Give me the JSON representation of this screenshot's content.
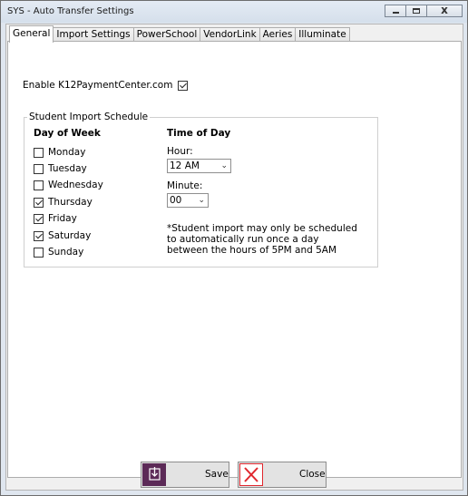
{
  "window": {
    "title": "SYS - Auto Transfer Settings",
    "close_glyph": "x"
  },
  "tabs": [
    {
      "label": "General",
      "active": true
    },
    {
      "label": "Import Settings",
      "active": false
    },
    {
      "label": "PowerSchool",
      "active": false
    },
    {
      "label": "VendorLink",
      "active": false
    },
    {
      "label": "Aeries",
      "active": false
    },
    {
      "label": "Illuminate",
      "active": false
    }
  ],
  "general": {
    "enable_label": "Enable K12PaymentCenter.com",
    "enable_checked": true
  },
  "schedule": {
    "group_title": "Student Import Schedule",
    "day_heading": "Day of Week",
    "time_heading": "Time of Day",
    "days": [
      {
        "label": "Monday",
        "checked": false
      },
      {
        "label": "Tuesday",
        "checked": false
      },
      {
        "label": "Wednesday",
        "checked": false
      },
      {
        "label": "Thursday",
        "checked": true
      },
      {
        "label": "Friday",
        "checked": true
      },
      {
        "label": "Saturday",
        "checked": true
      },
      {
        "label": "Sunday",
        "checked": false
      }
    ],
    "hour_label": "Hour:",
    "hour_value": "12 AM",
    "minute_label": "Minute:",
    "minute_value": "00",
    "note": "*Student import may only be scheduled to automatically run once a day between the hours of 5PM and 5AM"
  },
  "buttons": {
    "save_label": "Save",
    "close_label": "Close"
  },
  "colors": {
    "save_icon_bg": "#5c2a57",
    "close_icon_red": "#e0262d"
  },
  "icons": {
    "save": "save-download-icon",
    "close": "close-x-icon",
    "dropdown": "chevron-down-icon"
  }
}
